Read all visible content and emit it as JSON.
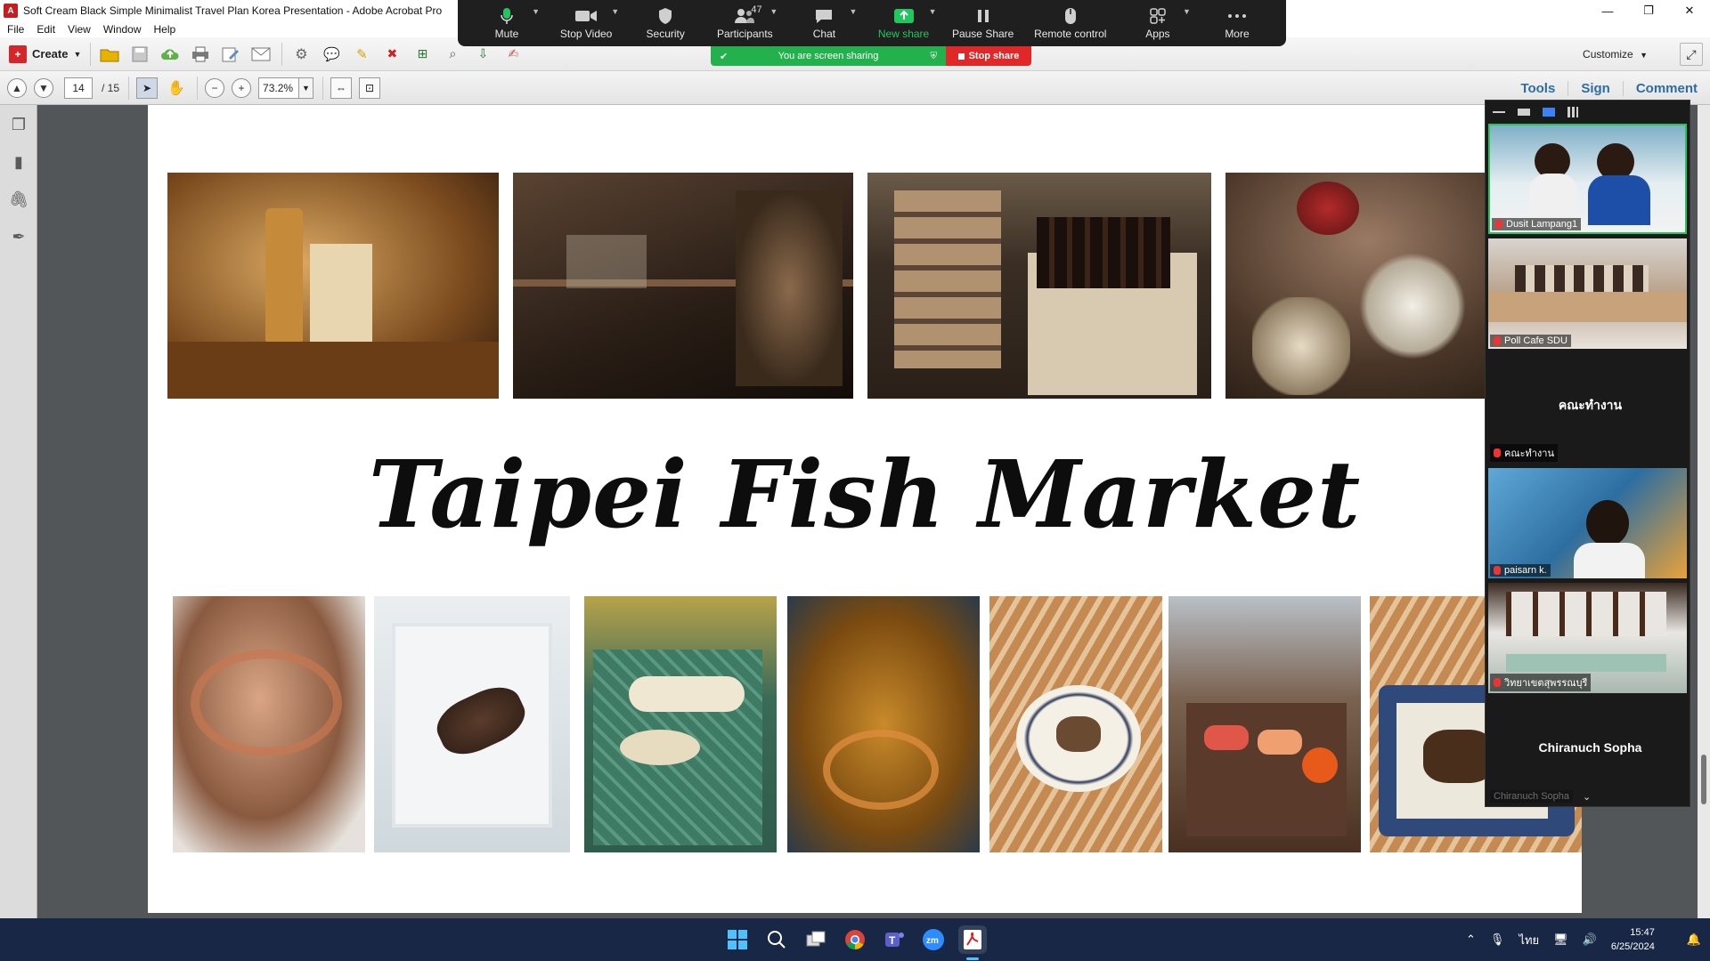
{
  "window": {
    "title": "Soft Cream Black Simple Minimalist Travel Plan Korea Presentation - Adobe Acrobat Pro",
    "controls": [
      "—",
      "❐",
      "✕"
    ]
  },
  "menu": [
    "File",
    "Edit",
    "View",
    "Window",
    "Help"
  ],
  "toolbar": {
    "create_label": "Create",
    "customize_label": "Customize"
  },
  "nav": {
    "page_current": "14",
    "page_total": "/ 15",
    "zoom": "73.2%"
  },
  "right_tabs": [
    "Tools",
    "Sign",
    "Comment"
  ],
  "slide": {
    "title": "Taipei Fish Market"
  },
  "zoom_controls": {
    "buttons": [
      {
        "label": "Mute",
        "icon": "mic-icon"
      },
      {
        "label": "Stop Video",
        "icon": "video-icon"
      },
      {
        "label": "Security",
        "icon": "shield-icon"
      },
      {
        "label": "Participants",
        "icon": "participants-icon",
        "count": "47"
      },
      {
        "label": "Chat",
        "icon": "chat-icon"
      },
      {
        "label": "New share",
        "icon": "share-icon"
      },
      {
        "label": "Pause Share",
        "icon": "pause-icon"
      },
      {
        "label": "Remote control",
        "icon": "mouse-icon"
      },
      {
        "label": "Apps",
        "icon": "apps-icon"
      },
      {
        "label": "More",
        "icon": "more-icon"
      }
    ],
    "sharing_text": "You are screen sharing",
    "stop_share_label": "Stop share"
  },
  "participants": [
    {
      "name": "Dusit Lampang1"
    },
    {
      "name": "Poll Cafe SDU"
    },
    {
      "name": "คณะทำงาน",
      "label": "คณะทำงาน"
    },
    {
      "name": "paisarn k."
    },
    {
      "name": "วิทยาเขตสุพรรณบุรี"
    },
    {
      "name": "Chiranuch Sopha",
      "label": "Chiranuch Sopha"
    }
  ],
  "tray": {
    "language": "ไทย",
    "time": "15:47",
    "date": "6/25/2024"
  },
  "colors": {
    "zoom_green": "#22b14c",
    "zoom_red": "#e02828",
    "acrobat_red": "#d6262a",
    "taskbar": "#182746"
  }
}
